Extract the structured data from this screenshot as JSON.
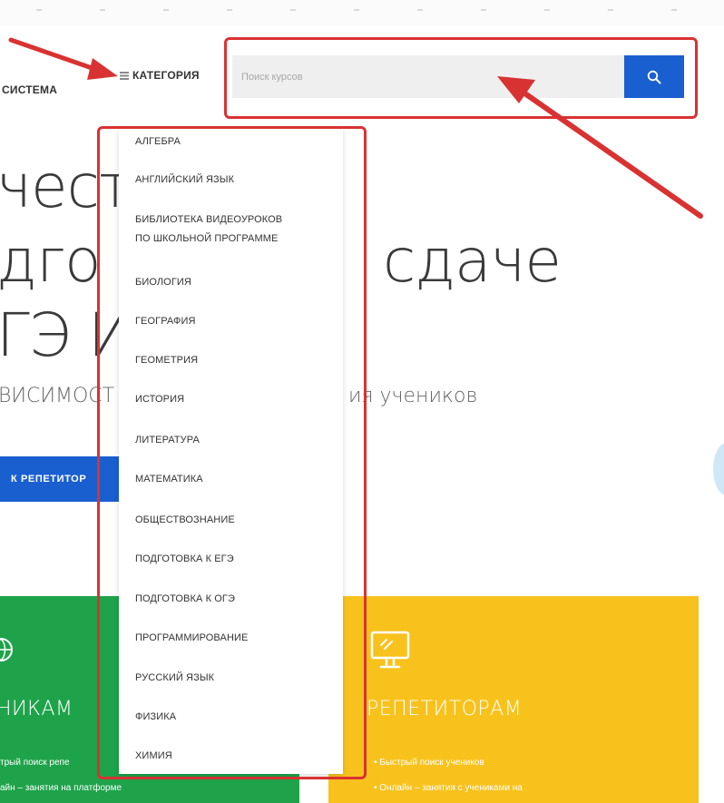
{
  "header": {
    "brand_fragment": "СИСТЕМА",
    "category_label": "КАТЕГОРИЯ",
    "search_placeholder": "Поиск курсов"
  },
  "hero": {
    "title_line1": "чест",
    "title_line2_a": "дго",
    "title_line2_b": "сдаче",
    "title_line3": "ГЭ И",
    "subtitle_a": "ВИСИМОСТ",
    "subtitle_b": "ия учеников",
    "cta_label": "К РЕПЕТИТОР"
  },
  "dropdown": {
    "items": [
      "АЛГЕБРА",
      "АНГЛИЙСКИЙ ЯЗЫК",
      "БИБЛИОТЕКА ВИДЕОУРОКОВ",
      "ПО ШКОЛЬНОЙ ПРОГРАММЕ",
      "БИОЛОГИЯ",
      "ГЕОГРАФИЯ",
      "ГЕОМЕТРИЯ",
      "ИСТОРИЯ",
      "ЛИТЕРАТУРА",
      "МАТЕМАТИКА",
      "ОБЩЕСТВОЗНАНИЕ",
      "ПОДГОТОВКА К ЕГЭ",
      "ПОДГОТОВКА К ОГЭ",
      "ПРОГРАММИРОВАНИЕ",
      "РУССКИЙ ЯЗЫК",
      "ФИЗИКА",
      "ХИМИЯ"
    ]
  },
  "cards": {
    "students_title": "НИКАМ",
    "students_bullet1": "трый поиск репе",
    "students_bullet2": "айн – занятия на платформе",
    "tutors_title": "РЕПЕТИТОРАМ",
    "tutors_bullet1": "Быстрый поиск учеников",
    "tutors_bullet2": "Онлайн – занятия с учениками на"
  },
  "colors": {
    "accent_blue": "#1a5fd0",
    "annotation_red": "#d93232",
    "card_green": "#1ea34a",
    "card_yellow": "#f8c21d"
  },
  "icons": {
    "search": "search-icon",
    "category": "menu-icon",
    "tutors_card": "monitor-icon",
    "students_card": "globe-icon"
  }
}
